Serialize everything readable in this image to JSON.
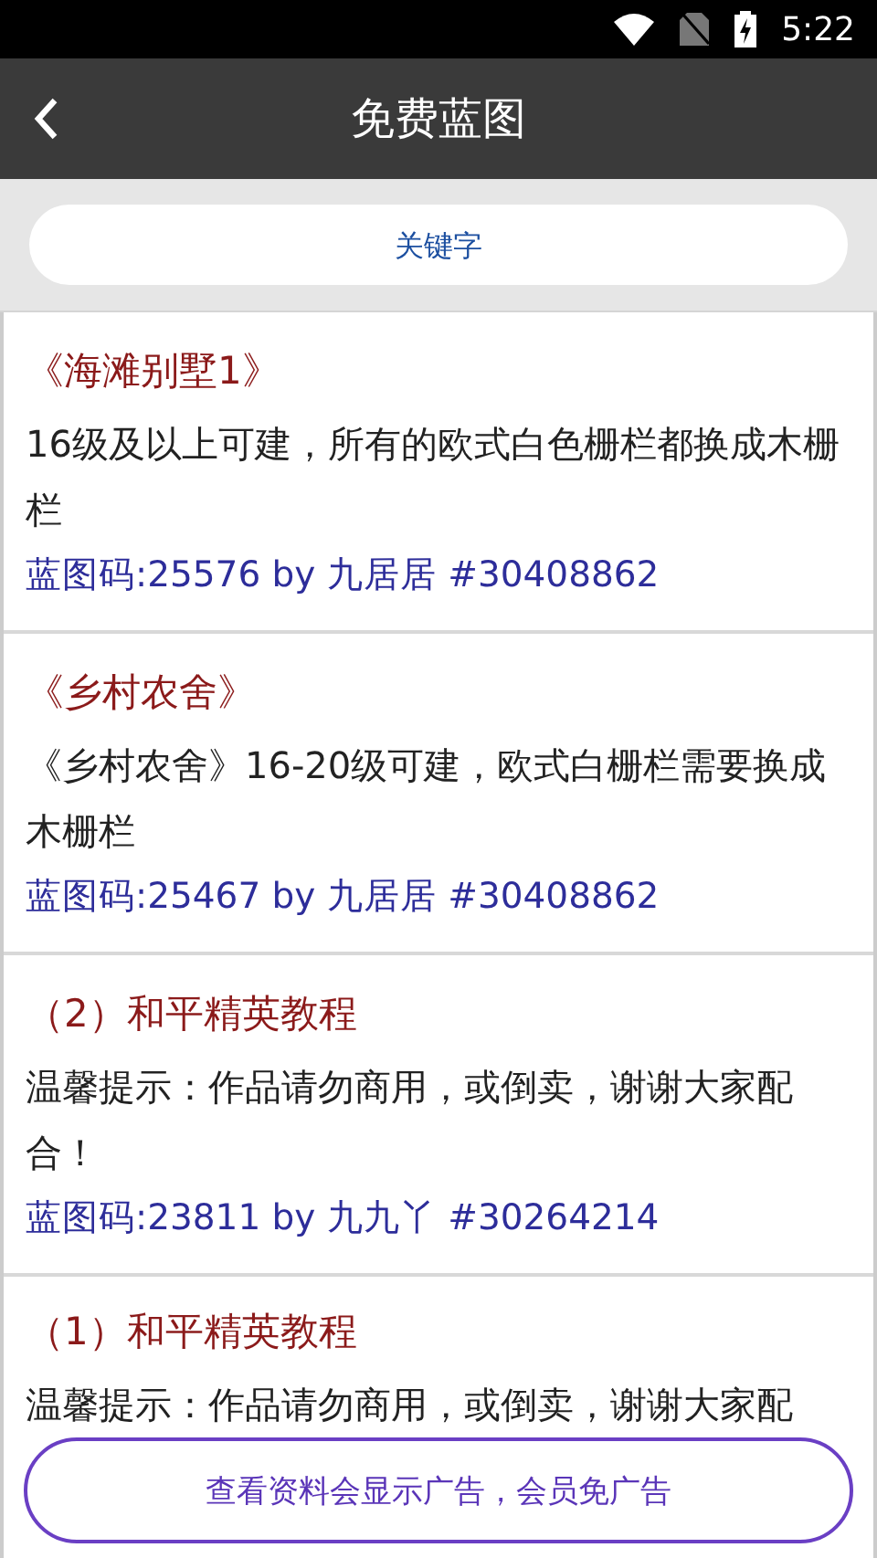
{
  "status_bar": {
    "time": "5:22"
  },
  "header": {
    "title": "免费蓝图"
  },
  "search": {
    "placeholder": "关键字"
  },
  "items": [
    {
      "title": "《海滩别墅1》",
      "description": "16级及以上可建，所有的欧式白色栅栏都换成木栅栏",
      "code": "蓝图码:25576 by 九居居 #30408862"
    },
    {
      "title": "《乡村农舍》",
      "description": "《乡村农舍》16-20级可建，欧式白栅栏需要换成木栅栏",
      "code": "蓝图码:25467 by 九居居 #30408862"
    },
    {
      "title": "（2）和平精英教程",
      "description": "温馨提示：作品请勿商用，或倒卖，谢谢大家配合！",
      "code": "蓝图码:23811 by 九九丫 #30264214"
    },
    {
      "title": "（1）和平精英教程",
      "description": "温馨提示：作品请勿商用，或倒卖，谢谢大家配"
    }
  ],
  "ad_button": {
    "label": "查看资料会显示广告，会员免广告"
  }
}
